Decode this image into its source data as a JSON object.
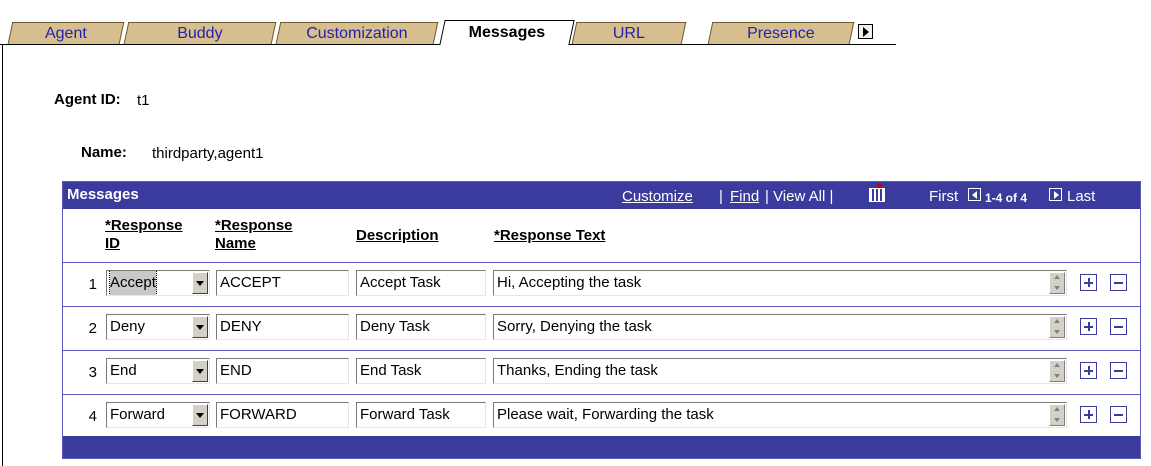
{
  "tabs": [
    {
      "label": "Agent",
      "active": false
    },
    {
      "label": "Buddy",
      "active": false
    },
    {
      "label": "Customization",
      "active": false
    },
    {
      "label": "Messages",
      "active": true
    },
    {
      "label": "URL",
      "active": false
    },
    {
      "label": "Presence",
      "active": false
    }
  ],
  "tab_next_icon": "right-arrow-icon",
  "agent": {
    "id_label": "Agent ID:",
    "id_value": "t1",
    "name_label": "Name:",
    "name_value": "thirdparty,agent1"
  },
  "grid": {
    "title": "Messages",
    "customize": "Customize",
    "sep1": "|",
    "find": "Find",
    "view_all": "| View All |",
    "first": "First",
    "range": "1-4 of 4",
    "last": "Last",
    "columns": {
      "response_id_1": "*Response",
      "response_id_2": "ID",
      "response_name_1": "*Response",
      "response_name_2": "Name",
      "description": "Description",
      "response_text": "*Response Text"
    },
    "rows": [
      {
        "num": "1",
        "response_id": "Accept",
        "response_name": "ACCEPT",
        "description": "Accept Task",
        "response_text": "Hi, Accepting the task"
      },
      {
        "num": "2",
        "response_id": "Deny",
        "response_name": "DENY",
        "description": "Deny Task",
        "response_text": "Sorry, Denying the task"
      },
      {
        "num": "3",
        "response_id": "End",
        "response_name": "END",
        "description": "End Task",
        "response_text": "Thanks, Ending the task"
      },
      {
        "num": "4",
        "response_id": "Forward",
        "response_name": "FORWARD",
        "description": "Forward Task",
        "response_text": "Please wait, Forwarding the task"
      }
    ]
  },
  "colors": {
    "header_bg": "#3b3b9e",
    "tab_bg": "#d6be8e",
    "link": "#2222aa"
  }
}
